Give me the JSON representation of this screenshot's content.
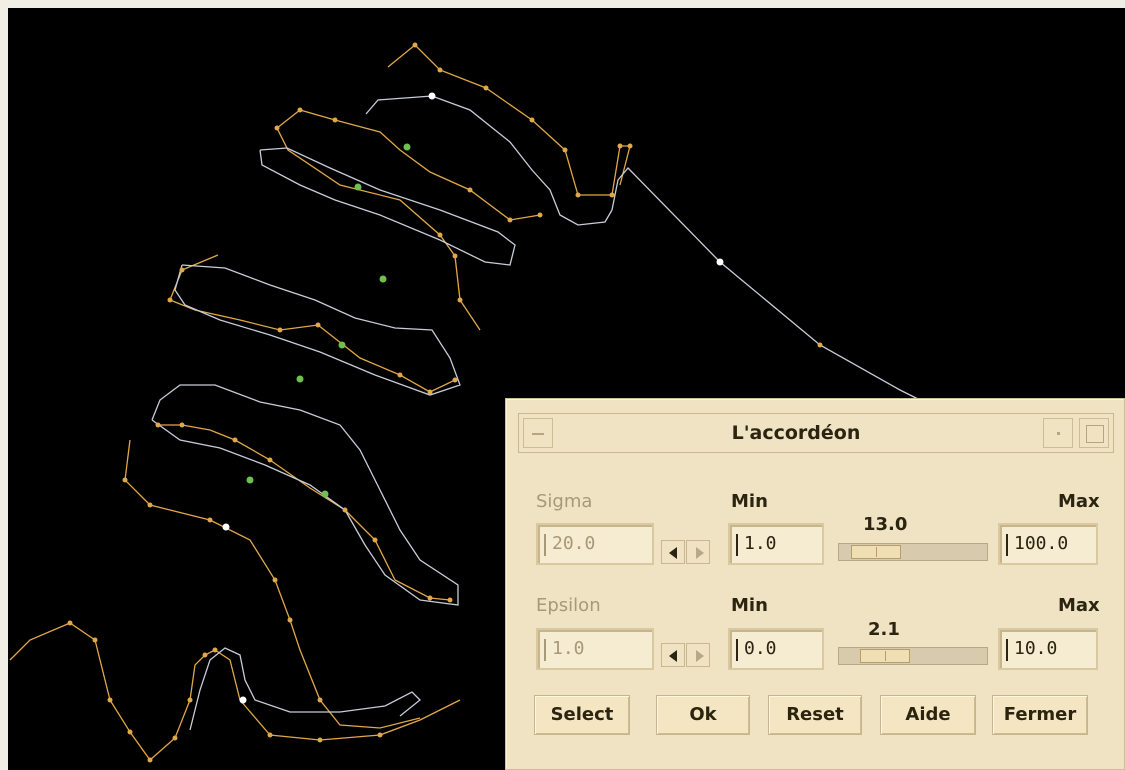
{
  "window": {
    "title": "L'accordéon"
  },
  "sigma": {
    "label": "Sigma",
    "value": "20.0",
    "min_label": "Min",
    "min_value": "1.0",
    "max_label": "Max",
    "max_value": "100.0",
    "slider_value": "13.0",
    "slider_fraction": 0.12
  },
  "epsilon": {
    "label": "Epsilon",
    "value": "1.0",
    "min_label": "Min",
    "min_value": "0.0",
    "max_label": "Max",
    "max_value": "10.0",
    "slider_value": "2.1",
    "slider_fraction": 0.21
  },
  "buttons": {
    "select": "Select",
    "ok": "Ok",
    "reset": "Reset",
    "aide": "Aide",
    "fermer": "Fermer"
  },
  "colors": {
    "background": "#000000",
    "orange_curve": "#e0a848",
    "white_curve": "#c8ccd8",
    "green_point": "#70c050",
    "white_point": "#ffffff",
    "dialog_bg": "#efe3c4"
  }
}
